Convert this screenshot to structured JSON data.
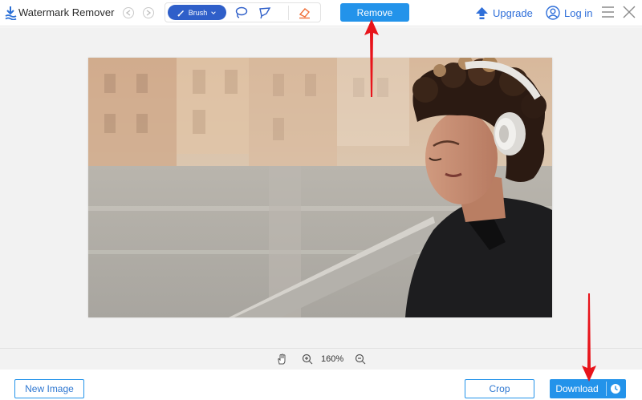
{
  "app": {
    "title": "Watermark Remover"
  },
  "toolbar": {
    "brush_label": "Brush",
    "remove_label": "Remove",
    "upgrade_label": "Upgrade",
    "login_label": "Log in"
  },
  "zoom": {
    "level": "160%"
  },
  "footer": {
    "new_image_label": "New Image",
    "crop_label": "Crop",
    "download_label": "Download"
  },
  "colors": {
    "primary": "#2393ea",
    "brush_active": "#2f5fc9",
    "link": "#2f6fd9",
    "annotation_arrow": "#e8141b",
    "canvas_bg": "#f2f2f2"
  },
  "icons": {
    "logo": "wave-logo-icon",
    "undo": "undo-icon",
    "redo": "redo-icon",
    "brush": "brush-icon",
    "lasso": "lasso-icon",
    "polygon_lasso": "polygon-lasso-icon",
    "eraser": "eraser-icon",
    "upgrade": "upload-arrow-icon",
    "user": "user-icon",
    "menu": "hamburger-menu-icon",
    "close": "close-icon",
    "hand": "hand-pan-icon",
    "zoom_in": "zoom-in-icon",
    "zoom_out": "zoom-out-icon",
    "history": "clock-icon"
  }
}
